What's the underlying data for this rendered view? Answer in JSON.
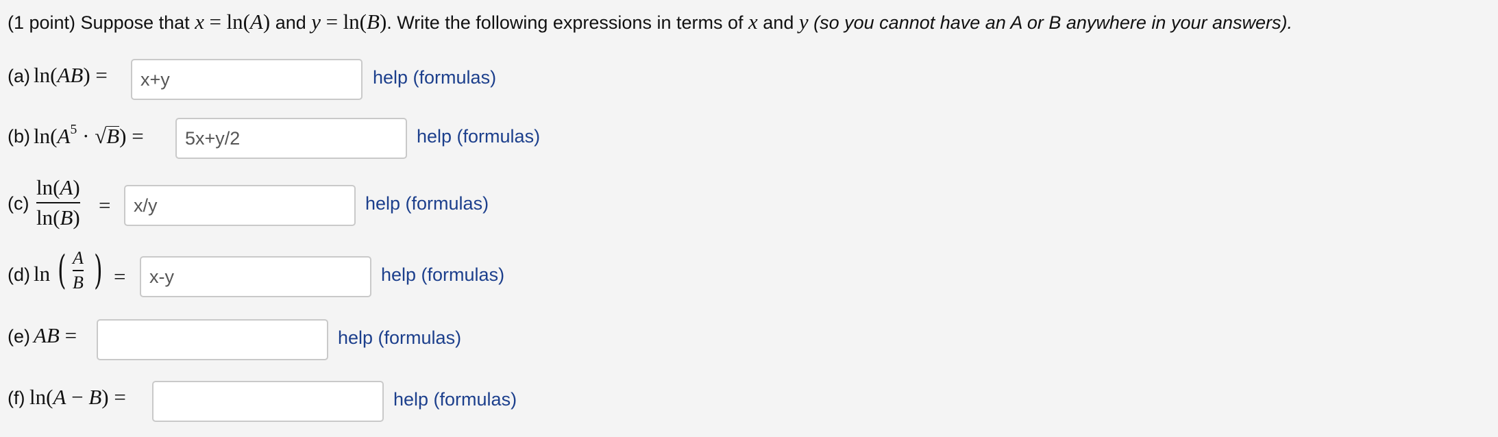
{
  "intro": {
    "prefix": "(1 point) Suppose that",
    "x_var": "x",
    "eq1": "=",
    "ln_a": "ln(A)",
    "and1": "and",
    "y_var": "y",
    "eq2": "=",
    "ln_b": "ln(B)",
    "middle": ". Write the following expressions in terms of",
    "x_var2": "x",
    "and2": "and",
    "y_var2": "y",
    "italic_note": "(so you cannot have an A or B anywhere in your answers)."
  },
  "parts": [
    {
      "label": "(a)",
      "expr_text": "ln(AB) =",
      "value": "x+y",
      "help": "help (formulas)"
    },
    {
      "label": "(b)",
      "expr_ln": "ln(",
      "expr_A": "A",
      "expr_exp": "5",
      "expr_dot": " · √",
      "expr_B": "B",
      "expr_close": ") =",
      "value": "5x+y/2",
      "help": "help (formulas)"
    },
    {
      "label": "(c)",
      "num": "ln(A)",
      "den": "ln(B)",
      "eq": "=",
      "value": "x/y",
      "help": "help (formulas)"
    },
    {
      "label": "(d)",
      "ln": "ln",
      "num": "A",
      "den": "B",
      "eq": "=",
      "value": "x-y",
      "help": "help (formulas)"
    },
    {
      "label": "(e)",
      "expr_text": "AB =",
      "value": "",
      "help": "help (formulas)"
    },
    {
      "label": "(f)",
      "expr_text": "ln(A − B) =",
      "value": "",
      "help": "help (formulas)"
    }
  ],
  "colors": {
    "background": "#f4f4f4",
    "link": "#1c3f8c",
    "input_border": "#c9c9c9"
  }
}
